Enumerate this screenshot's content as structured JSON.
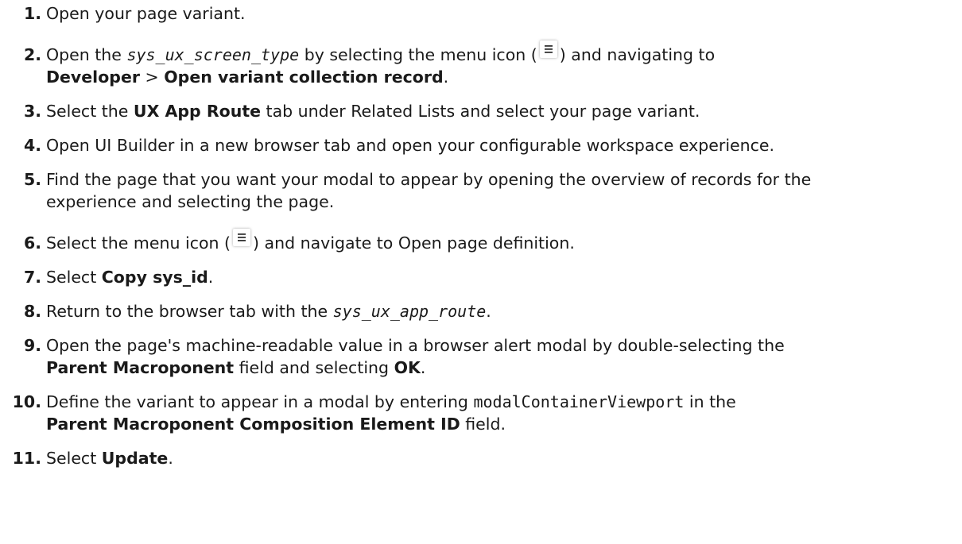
{
  "steps": [
    {
      "num": "1.",
      "text": "Open your page variant."
    },
    {
      "num": "2.",
      "a": "Open the ",
      "code": "sys_ux_screen_type",
      "b": " by selecting the menu icon (",
      "c": ") and navigating to",
      "bold1": "Developer",
      "sep": " > ",
      "bold2": "Open variant collection record",
      "end": "."
    },
    {
      "num": "3.",
      "a": "Select the ",
      "bold": "UX App Route",
      "b": " tab under Related Lists and select your page variant."
    },
    {
      "num": "4.",
      "text": "Open UI Builder in a new browser tab and open your configurable workspace experience."
    },
    {
      "num": "5.",
      "line1": "Find the page that you want your modal to appear by opening the overview of records for the",
      "line2": "experience and selecting the page."
    },
    {
      "num": "6.",
      "a": "Select the menu icon (",
      "b": ") and navigate to Open page definition."
    },
    {
      "num": "7.",
      "a": "Select ",
      "bold": "Copy sys_id",
      "b": "."
    },
    {
      "num": "8.",
      "a": "Return to the browser tab with the ",
      "code": "sys_ux_app_route",
      "b": "."
    },
    {
      "num": "9.",
      "line1": "Open the page's machine-readable value in a browser alert modal by double-selecting the",
      "bold1": "Parent Macroponent",
      "mid": " field and selecting ",
      "bold2": "OK",
      "end": "."
    },
    {
      "num": "10.",
      "a": "Define the variant to appear in a modal by entering ",
      "code": "modalContainerViewport",
      "b": " in the",
      "bold": "Parent Macroponent Composition Element ID",
      "c": " field."
    },
    {
      "num": "11.",
      "a": "Select ",
      "bold": "Update",
      "b": "."
    }
  ],
  "icons": {
    "menu": "hamburger-menu-icon"
  }
}
